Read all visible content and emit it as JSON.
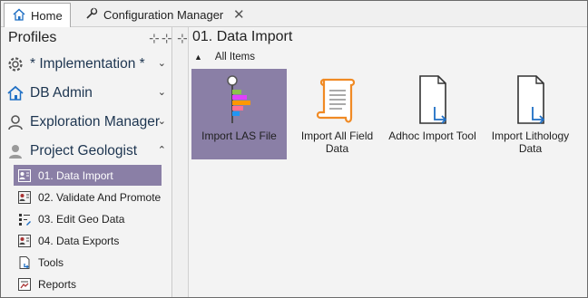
{
  "tabs": {
    "home": "Home",
    "config": "Configuration Manager",
    "close_glyph": "✕"
  },
  "sidebar": {
    "title": "Profiles",
    "groups": [
      {
        "label": "* Implementation *",
        "icon": "gear-icon",
        "expanded": false
      },
      {
        "label": "DB Admin",
        "icon": "home-icon",
        "expanded": false
      },
      {
        "label": "Exploration Manager",
        "icon": "person-icon",
        "expanded": false
      },
      {
        "label": "Project Geologist",
        "icon": "person-icon",
        "expanded": true
      }
    ],
    "items": [
      {
        "label": "01. Data Import",
        "icon": "person-form-icon",
        "selected": true
      },
      {
        "label": "02. Validate And Promote",
        "icon": "person-form-icon",
        "selected": false
      },
      {
        "label": "03. Edit Geo Data",
        "icon": "list-edit-icon",
        "selected": false
      },
      {
        "label": "04. Data Exports",
        "icon": "person-form-icon",
        "selected": false
      },
      {
        "label": "Tools",
        "icon": "document-link-icon",
        "selected": false
      },
      {
        "label": "Reports",
        "icon": "report-icon",
        "selected": false
      }
    ]
  },
  "content": {
    "title": "01. Data Import",
    "section": "All Items",
    "tiles": [
      {
        "label": "Import LAS File",
        "icon": "las-log-icon",
        "selected": true
      },
      {
        "label": "Import All Field Data",
        "icon": "scroll-icon",
        "selected": false
      },
      {
        "label": "Adhoc Import Tool",
        "icon": "document-link-icon",
        "selected": false
      },
      {
        "label": "Import Lithology Data",
        "icon": "document-link-icon",
        "selected": false
      }
    ]
  },
  "colors": {
    "selection": "#8a7fa6",
    "accent_blue": "#1f6fc4",
    "scroll_orange": "#f08a24"
  }
}
